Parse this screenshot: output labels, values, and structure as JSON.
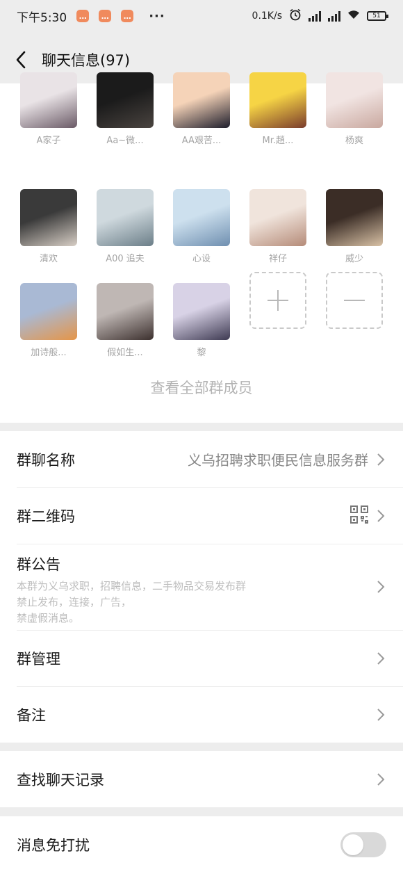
{
  "status_bar": {
    "time": "下午5:30",
    "dots": "···",
    "network_speed": "0.1K/s",
    "battery": "51"
  },
  "header": {
    "title": "聊天信息(97)"
  },
  "members": [
    {
      "name": "A家子",
      "colors": [
        "#e9e3e6",
        "#6a5a66"
      ]
    },
    {
      "name": "Aa~微...",
      "colors": [
        "#1b1b1b",
        "#4a4440"
      ]
    },
    {
      "name": "AA艰苦...",
      "colors": [
        "#f5d3b8",
        "#1d1d2b"
      ]
    },
    {
      "name": "Mr.趙...",
      "colors": [
        "#f6d445",
        "#7a3c2c"
      ]
    },
    {
      "name": "杨爽",
      "colors": [
        "#f1e4e2",
        "#c9a89f"
      ]
    },
    {
      "name": "清欢",
      "colors": [
        "#3a3a3a",
        "#d8cfc6"
      ]
    },
    {
      "name": "A00 追夫",
      "colors": [
        "#cfd9de",
        "#6b7e88"
      ]
    },
    {
      "name": "心设",
      "colors": [
        "#cde0ee",
        "#6f8fb0"
      ]
    },
    {
      "name": "祥仔",
      "colors": [
        "#f0e4dc",
        "#b58b78"
      ]
    },
    {
      "name": "威少",
      "colors": [
        "#3b2d26",
        "#d9c2a6"
      ]
    },
    {
      "name": "加诗般...",
      "colors": [
        "#a9b9d4",
        "#e59548"
      ]
    },
    {
      "name": "假如生...",
      "colors": [
        "#bfb7b4",
        "#3c302e"
      ]
    },
    {
      "name": "黎",
      "colors": [
        "#d8d2e6",
        "#3e3a52"
      ]
    }
  ],
  "member_actions": {
    "add_symbol": "+",
    "remove_symbol": "—"
  },
  "view_all_label": "查看全部群成员",
  "settings": {
    "group_name_label": "群聊名称",
    "group_name_value": "义乌招聘求职便民信息服务群",
    "qr_code_label": "群二维码",
    "announcement_label": "群公告",
    "announcement_text": "本群为义乌求职，招聘信息，二手物品交易发布群\n禁止发布，连接，广告，\n禁虚假消息。",
    "manage_label": "群管理",
    "remark_label": "备注",
    "search_history_label": "查找聊天记录",
    "mute_label": "消息免打扰",
    "mute_enabled": false
  },
  "colors": {
    "page_bg": "#ededed",
    "panel_bg": "#ffffff",
    "muted_text": "#a4a4a4",
    "notif_icon": "#f08a5d"
  }
}
